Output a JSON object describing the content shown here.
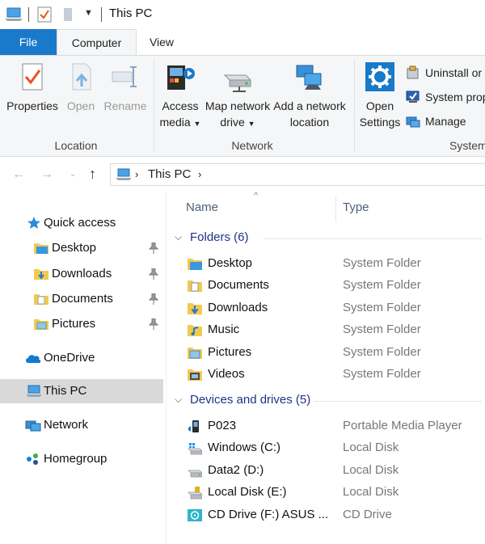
{
  "window": {
    "title": "This PC"
  },
  "tabs": {
    "file": "File",
    "computer": "Computer",
    "view": "View"
  },
  "ribbon": {
    "location": {
      "label": "Location",
      "properties": "Properties",
      "open": "Open",
      "rename": "Rename"
    },
    "network": {
      "label": "Network",
      "access_media_1": "Access",
      "access_media_2": "media",
      "map_drive_1": "Map network",
      "map_drive_2": "drive",
      "add_location_1": "Add a network",
      "add_location_2": "location"
    },
    "system": {
      "label": "System",
      "open_settings_1": "Open",
      "open_settings_2": "Settings",
      "uninstall": "Uninstall or",
      "system_props": "System prop",
      "manage": "Manage"
    }
  },
  "address": {
    "crumb": "This PC"
  },
  "nav": {
    "quick_access": "Quick access",
    "desktop": "Desktop",
    "downloads": "Downloads",
    "documents": "Documents",
    "pictures": "Pictures",
    "onedrive": "OneDrive",
    "this_pc": "This PC",
    "network": "Network",
    "homegroup": "Homegroup"
  },
  "columns": {
    "name": "Name",
    "type": "Type"
  },
  "groups": {
    "folders": "Folders (6)",
    "devices": "Devices and drives (5)"
  },
  "folders": [
    {
      "name": "Desktop",
      "type": "System Folder",
      "icon": "desktop-folder-icon"
    },
    {
      "name": "Documents",
      "type": "System Folder",
      "icon": "documents-folder-icon"
    },
    {
      "name": "Downloads",
      "type": "System Folder",
      "icon": "downloads-folder-icon"
    },
    {
      "name": "Music",
      "type": "System Folder",
      "icon": "music-folder-icon"
    },
    {
      "name": "Pictures",
      "type": "System Folder",
      "icon": "pictures-folder-icon"
    },
    {
      "name": "Videos",
      "type": "System Folder",
      "icon": "videos-folder-icon"
    }
  ],
  "devices": [
    {
      "name": "P023",
      "type": "Portable Media Player",
      "icon": "media-player-icon"
    },
    {
      "name": "Windows (C:)",
      "type": "Local Disk",
      "icon": "windows-disk-icon"
    },
    {
      "name": "Data2 (D:)",
      "type": "Local Disk",
      "icon": "disk-icon"
    },
    {
      "name": "Local Disk (E:)",
      "type": "Local Disk",
      "icon": "usb-disk-icon"
    },
    {
      "name": "CD Drive (F:) ASUS ...",
      "type": "CD Drive",
      "icon": "cd-drive-icon"
    }
  ],
  "colors": {
    "accent": "#1979ca",
    "group_text": "#1e3287",
    "selected_bg": "#d9d9d9"
  }
}
